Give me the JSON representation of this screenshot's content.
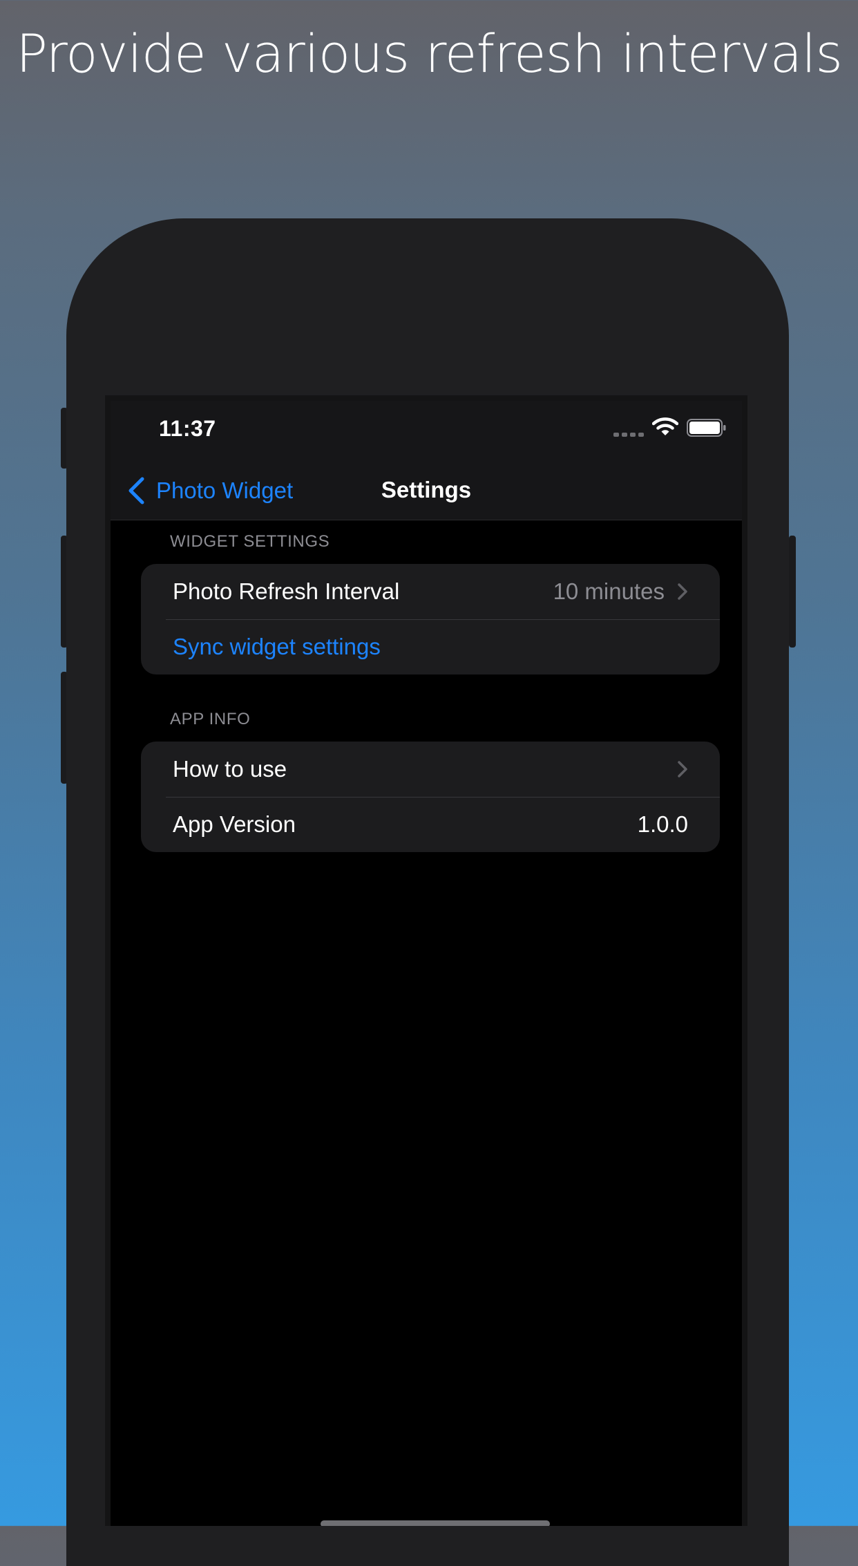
{
  "headline": "Provide various refresh intervals",
  "status_bar": {
    "time": "11:37",
    "icons": [
      "cellular-signal-icon",
      "wifi-icon",
      "battery-icon"
    ]
  },
  "nav": {
    "back_label": "Photo Widget",
    "title": "Settings"
  },
  "sections": [
    {
      "header": "WIDGET SETTINGS",
      "rows": [
        {
          "label": "Photo Refresh Interval",
          "value": "10 minutes",
          "disclosure": true
        },
        {
          "label": "Sync widget settings",
          "style": "link"
        }
      ]
    },
    {
      "header": "APP INFO",
      "rows": [
        {
          "label": "How to use",
          "disclosure": true
        },
        {
          "label": "App Version",
          "value": "1.0.0"
        }
      ]
    }
  ],
  "colors": {
    "accent": "#1d84ff",
    "secondary_text": "#8d8d93",
    "cell_background": "#1c1c1e",
    "screen_background": "#000000"
  }
}
